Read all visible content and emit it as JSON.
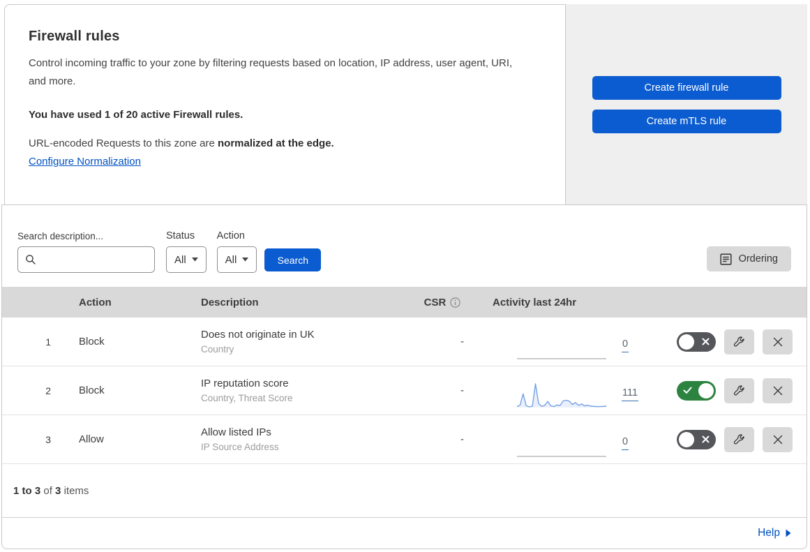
{
  "header": {
    "title": "Firewall rules",
    "description": "Control incoming traffic to your zone by filtering requests based on location, IP address, user agent, URI, and more.",
    "usage": "You have used 1 of 20 active Firewall rules.",
    "normalization_prefix": "URL-encoded Requests to this zone are ",
    "normalization_bold": "normalized at the edge.",
    "normalization_link": "Configure Normalization",
    "create_firewall_label": "Create firewall rule",
    "create_mtls_label": "Create mTLS rule"
  },
  "filters": {
    "search_label": "Search description...",
    "search_placeholder": "",
    "status_label": "Status",
    "status_value": "All",
    "action_label": "Action",
    "action_value": "All",
    "search_button": "Search",
    "ordering_button": "Ordering"
  },
  "table": {
    "columns": {
      "action": "Action",
      "description": "Description",
      "csr": "CSR",
      "activity": "Activity last 24hr"
    },
    "rows": [
      {
        "index": "1",
        "action": "Block",
        "title": "Does not originate in UK",
        "subtitle": "Country",
        "csr": "-",
        "count": "0",
        "enabled": false,
        "sparkline": []
      },
      {
        "index": "2",
        "action": "Block",
        "title": "IP reputation score",
        "subtitle": "Country, Threat Score",
        "csr": "-",
        "count": "111",
        "enabled": true,
        "sparkline": [
          4,
          10,
          58,
          8,
          3,
          6,
          100,
          18,
          5,
          9,
          26,
          7,
          4,
          11,
          9,
          28,
          31,
          27,
          13,
          21,
          9,
          15,
          7,
          10,
          6,
          5,
          4,
          4,
          5,
          6
        ]
      },
      {
        "index": "3",
        "action": "Allow",
        "title": "Allow listed IPs",
        "subtitle": "IP Source Address",
        "csr": "-",
        "count": "0",
        "enabled": false,
        "sparkline": []
      }
    ]
  },
  "footer": {
    "range": "1 to 3",
    "of": "of",
    "total": "3",
    "items": "items",
    "help": "Help"
  },
  "colors": {
    "primary_blue": "#0b5cd0",
    "link_blue": "#0051c3",
    "toggle_green": "#2c833f",
    "toggle_off_gray": "#54565a",
    "spark_line": "#76a1e6",
    "spark_fill": "#eaf0fb",
    "flat_line": "#aeaeae",
    "table_header_bg": "#d9d9d9"
  }
}
